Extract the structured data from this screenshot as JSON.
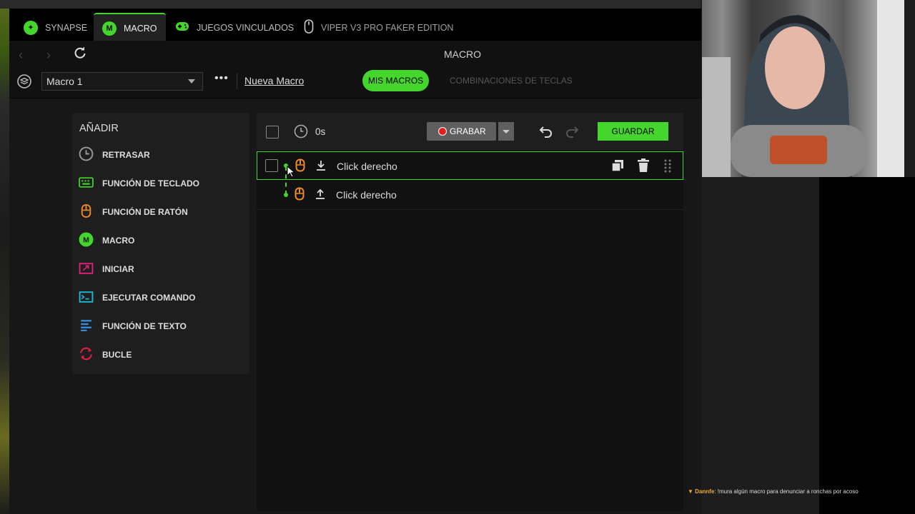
{
  "tabs": [
    {
      "label": "SYNAPSE",
      "icon": "synapse-icon"
    },
    {
      "label": "MACRO",
      "icon": "macro-icon",
      "active": true
    },
    {
      "label": "JUEGOS VINCULADOS",
      "icon": "gamepad-icon"
    },
    {
      "label": "VIPER V3 PRO FAKER EDITION",
      "icon": "mouse-icon"
    }
  ],
  "page_title": "MACRO",
  "toolbar": {
    "macro_select": "Macro 1",
    "more": "•••",
    "new_macro": "Nueva Macro",
    "tab_mine": "MIS MACROS",
    "tab_combos": "COMBINACIONES DE TECLAS"
  },
  "add_panel": {
    "title": "AÑADIR",
    "items": [
      {
        "label": "RETRASAR",
        "icon": "clock-icon",
        "color": "#9a9a9a"
      },
      {
        "label": "FUNCIÓN DE TECLADO",
        "icon": "keyboard-icon",
        "color": "#44d62c"
      },
      {
        "label": "FUNCIÓN DE RATÓN",
        "icon": "mouse-icon",
        "color": "#f08a24"
      },
      {
        "label": "MACRO",
        "icon": "macro-icon",
        "color": "#44d62c"
      },
      {
        "label": "INICIAR",
        "icon": "launch-icon",
        "color": "#e0207a"
      },
      {
        "label": "EJECUTAR COMANDO",
        "icon": "terminal-icon",
        "color": "#1fb6d6"
      },
      {
        "label": "FUNCIÓN DE TEXTO",
        "icon": "text-icon",
        "color": "#3a8dde"
      },
      {
        "label": "BUCLE",
        "icon": "loop-icon",
        "color": "#e02040"
      }
    ]
  },
  "editor": {
    "delay": "0s",
    "record_label": "GRABAR",
    "save_label": "GUARDAR",
    "rows": [
      {
        "label": "Click derecho",
        "direction": "down"
      },
      {
        "label": "Click derecho",
        "direction": "up"
      }
    ]
  },
  "chat": {
    "user": "Dannfe",
    "message": "!mura algún macro para denunciar a ronchas por acoso"
  },
  "colors": {
    "accent": "#44d62c",
    "mouse_action": "#f08a24"
  }
}
